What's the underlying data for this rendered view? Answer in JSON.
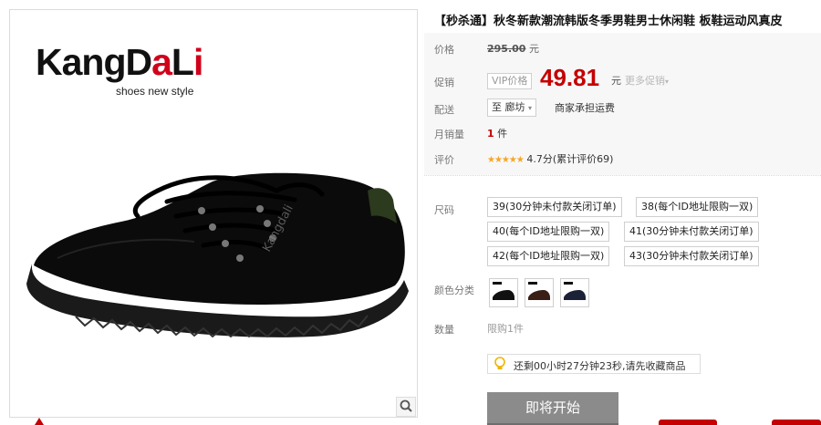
{
  "product": {
    "brand_logo": {
      "part1": "KangD",
      "accent": "a",
      "part2": "L",
      "accent2": "i"
    },
    "tagline": "shoes new style",
    "shoe_heel_text": "Kangdali",
    "title": "【秒杀通】秋冬新款潮流韩版冬季男鞋男士休闲鞋 板鞋运动风真皮"
  },
  "price": {
    "label": "价格",
    "original": "295.00",
    "currency_unit": "元",
    "promo_label": "促销",
    "vip_label": "VIP价格",
    "promo_price": "49.81",
    "more_label": "更多促销"
  },
  "shipping": {
    "label": "配送",
    "destination": "至 廊坊",
    "note": "商家承担运费"
  },
  "sales": {
    "label": "月销量",
    "count": "1",
    "unit": "件"
  },
  "rating": {
    "label": "评价",
    "stars": "★★★★★",
    "score": "4.7分(累计评价69)"
  },
  "size": {
    "label": "尺码",
    "options": [
      "39(30分钟未付款关闭订单)",
      "38(每个ID地址限购一双)",
      "40(每个ID地址限购一双)",
      "41(30分钟未付款关闭订单)",
      "42(每个ID地址限购一双)",
      "43(30分钟未付款关闭订单)"
    ]
  },
  "color": {
    "label": "颜色分类",
    "swatch_colors": [
      "#111111",
      "#3a1f16",
      "#1b2238"
    ]
  },
  "quantity": {
    "label": "数量",
    "limit": "限购1件"
  },
  "notice": "还剩00小时27分钟23秒,请先收藏商品",
  "buy_button": "即将开始",
  "colors": {
    "accent": "#c40000",
    "button": "#8b8b8b"
  }
}
